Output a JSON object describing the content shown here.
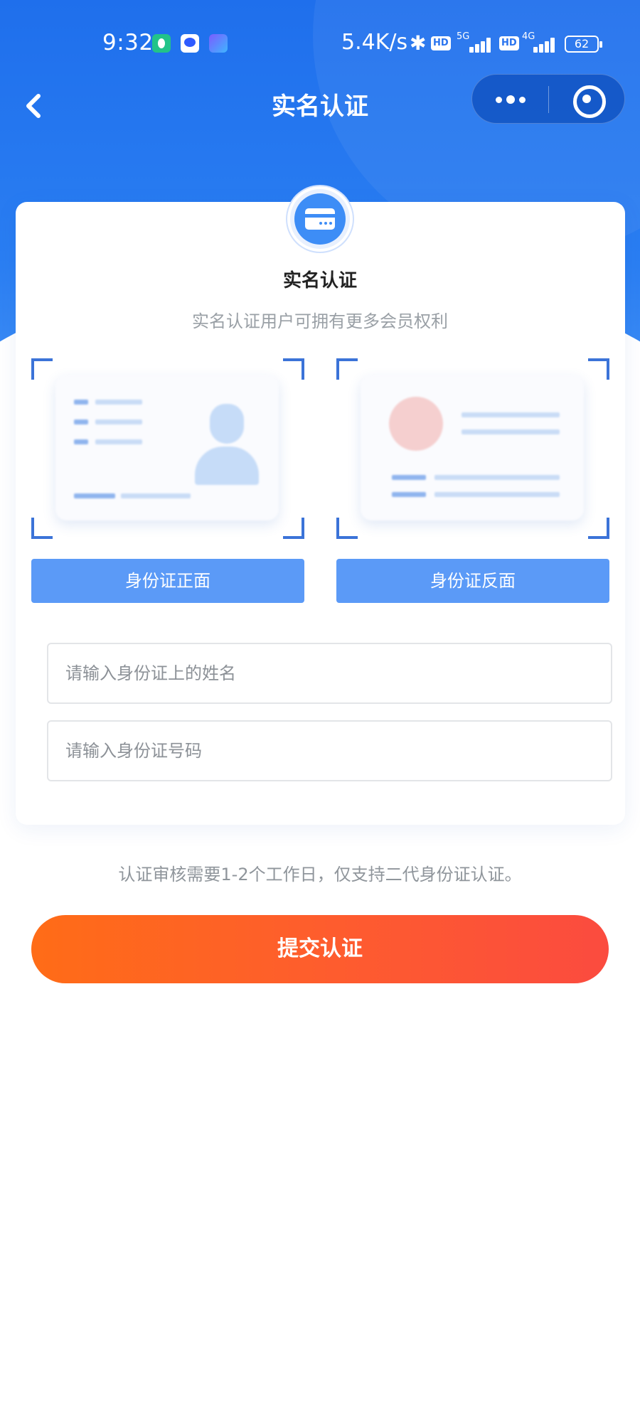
{
  "status_bar": {
    "time": "9:32",
    "net_speed": "5.4K/s",
    "hd_1": "HD",
    "gen_1": "5G",
    "hd_2": "HD",
    "gen_2": "4G",
    "battery": "62",
    "icons": [
      "shield-app-icon",
      "baidu-app-icon",
      "chat-app-icon",
      "bluetooth-icon",
      "signal-icon",
      "battery-icon"
    ]
  },
  "nav": {
    "title": "实名认证",
    "back_icon": "chevron-left-icon",
    "more_icon": "more-dots-icon",
    "close_icon": "target-circle-icon"
  },
  "header": {
    "badge_icon": "credit-card-icon",
    "title": "实名认证",
    "subtitle": "实名认证用户可拥有更多会员权利"
  },
  "id_upload": {
    "front_label": "身份证正面",
    "back_label": "身份证反面"
  },
  "form": {
    "name_placeholder": "请输入身份证上的姓名",
    "id_placeholder": "请输入身份证号码"
  },
  "notice": "认证审核需要1-2个工作日，仅支持二代身份证认证。",
  "submit_label": "提交认证",
  "colors": {
    "primary": "#2a7ef2",
    "id_button": "#5b9af7",
    "submit_start": "#ff6c17",
    "submit_end": "#fb4b3f",
    "frame": "#3b73d8"
  }
}
